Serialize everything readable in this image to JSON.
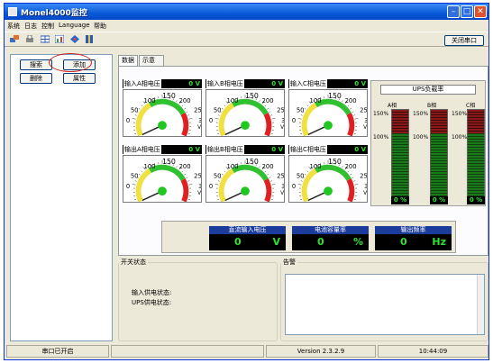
{
  "window": {
    "title": "Monel4000监控"
  },
  "menu": {
    "items": [
      "系统",
      "日志",
      "控制",
      "Language",
      "帮助"
    ]
  },
  "toolbar": {
    "icons": [
      "connect-icon",
      "print-icon",
      "grid-icon",
      "chart-icon",
      "shield-icon",
      "book-icon"
    ],
    "close_port_label": "关闭串口"
  },
  "left_panel": {
    "search": "搜索",
    "add": "添加",
    "delete": "删除",
    "properties": "属性"
  },
  "tabs": [
    {
      "label": "数据",
      "active": true
    },
    {
      "label": "示意图",
      "active": false
    }
  ],
  "gauges": [
    {
      "label": "输入A相电压",
      "value": "0",
      "unit": "V",
      "level": 0
    },
    {
      "label": "输入B相电压",
      "value": "0",
      "unit": "V",
      "level": 0
    },
    {
      "label": "输入C相电压",
      "value": "0",
      "unit": "V",
      "level": 0
    },
    {
      "label": "输出A相电压",
      "value": "0",
      "unit": "V",
      "level": 0
    },
    {
      "label": "输出B相电压",
      "value": "0",
      "unit": "V",
      "level": 0
    },
    {
      "label": "输出C相电压",
      "value": "0",
      "unit": "V",
      "level": 0
    }
  ],
  "gauge_scale": {
    "ticks": [
      "0",
      "50",
      "100",
      "150",
      "200",
      "250",
      "300"
    ],
    "unit": "V"
  },
  "ups_load": {
    "title": "UPS负载率",
    "phases": [
      {
        "label": "A相",
        "value": "0",
        "unit": "%"
      },
      {
        "label": "B相",
        "value": "0",
        "unit": "%"
      },
      {
        "label": "C相",
        "value": "0",
        "unit": "%"
      }
    ],
    "pct_high": "150%",
    "pct_mid": "100%"
  },
  "readouts": [
    {
      "title": "直流输入电压",
      "value": "0",
      "unit": "V"
    },
    {
      "title": "电池容量率",
      "value": "0",
      "unit": "%"
    },
    {
      "title": "输出频率",
      "value": "0",
      "unit": "Hz"
    }
  ],
  "switch_status": {
    "title": "开关状态",
    "input_power": "输入供电状态:",
    "ups_power": "UPS供电状态:"
  },
  "alarm": {
    "title": "告警"
  },
  "statusbar": {
    "port": "串口已开启",
    "version": "Version 2.3.2.9",
    "time": "10:44:09"
  },
  "colors": {
    "titlebar": "#0A5AD8",
    "window_bg": "#ECE9D8",
    "readout_bg": "#000000",
    "readout_text": "#30E030",
    "gauge_needle_pivot": "#1EC81E"
  }
}
